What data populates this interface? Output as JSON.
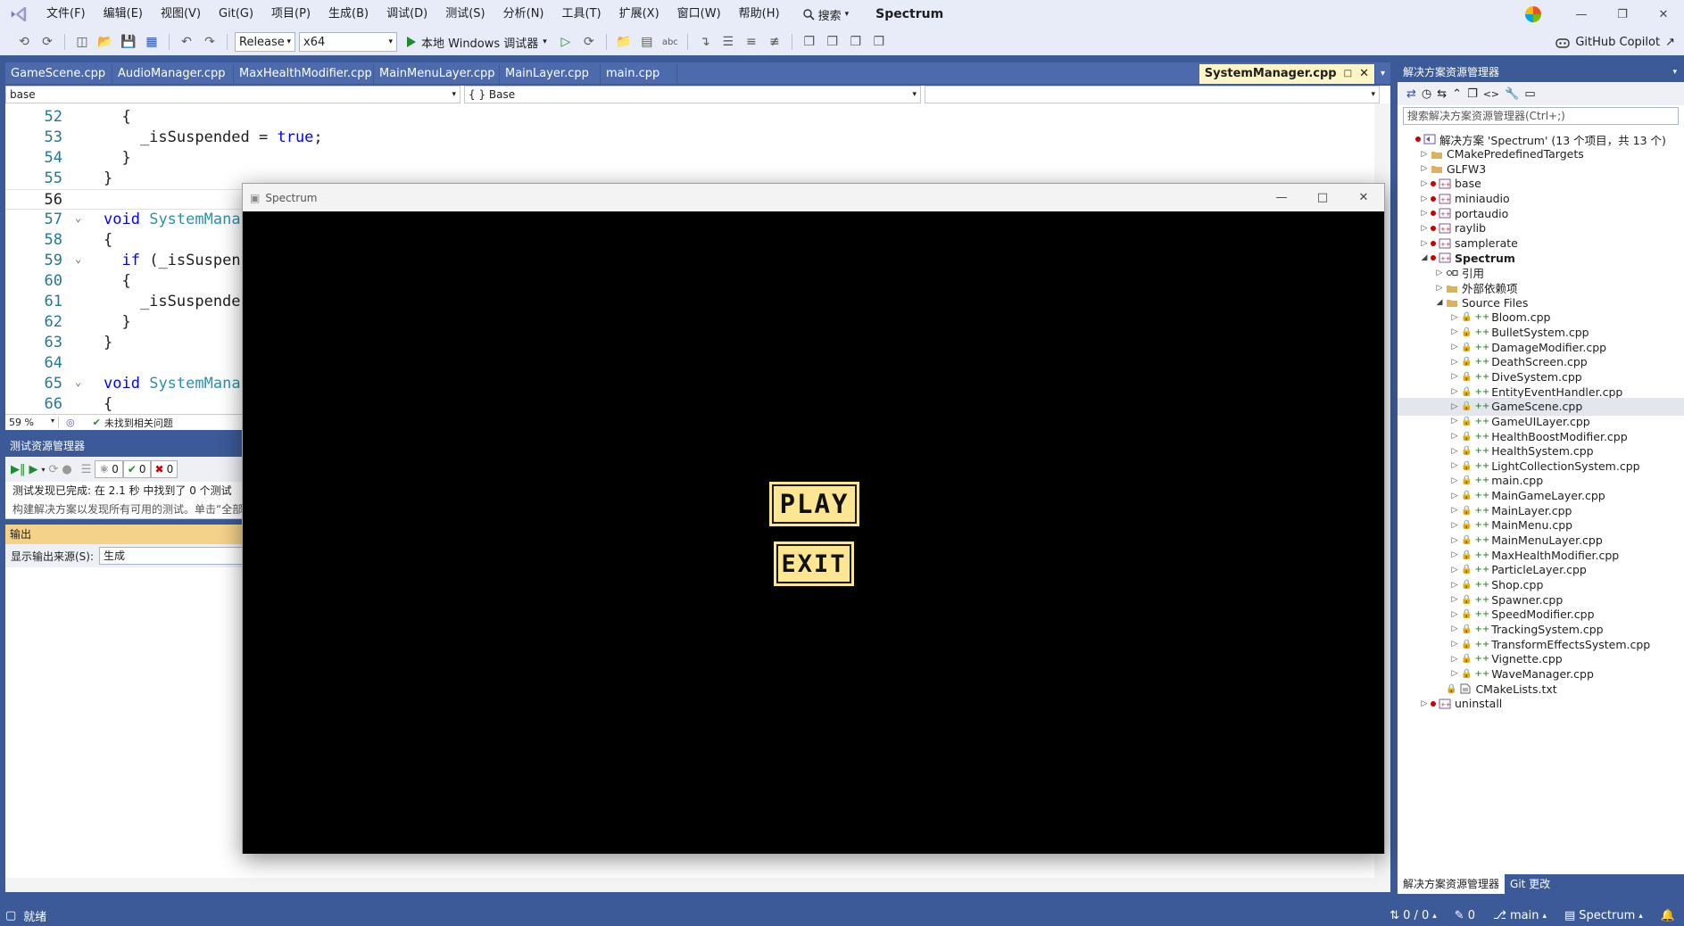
{
  "menu": [
    "文件(F)",
    "编辑(E)",
    "视图(V)",
    "Git(G)",
    "项目(P)",
    "生成(B)",
    "调试(D)",
    "测试(S)",
    "分析(N)",
    "工具(T)",
    "扩展(X)",
    "窗口(W)",
    "帮助(H)"
  ],
  "search_label": "搜索",
  "app_name": "Spectrum",
  "toolbar": {
    "config": "Release",
    "platform": "x64",
    "run_label": "本地 Windows 调试器",
    "copilot": "GitHub Copilot"
  },
  "doc_tabs": [
    "GameScene.cpp",
    "AudioManager.cpp",
    "MaxHealthModifier.cpp",
    "MainMenuLayer.cpp",
    "MainLayer.cpp",
    "main.cpp"
  ],
  "active_tab": "SystemManager.cpp",
  "nav": {
    "project": "base",
    "scope": "{ } Base",
    "member": ""
  },
  "code": [
    {
      "n": "52",
      "html": "  {"
    },
    {
      "n": "53",
      "html": "    _isSuspended = <span class=\"kw\">true</span>;"
    },
    {
      "n": "54",
      "html": "  }"
    },
    {
      "n": "55",
      "html": "}"
    },
    {
      "n": "56",
      "html": ""
    },
    {
      "n": "57",
      "html": "<span class=\"kw\">void</span> <span class=\"fn\">SystemMana</span>"
    },
    {
      "n": "58",
      "html": "{"
    },
    {
      "n": "59",
      "html": "  <span class=\"kw\">if</span> (_isSuspen"
    },
    {
      "n": "60",
      "html": "  {"
    },
    {
      "n": "61",
      "html": "    _isSuspende"
    },
    {
      "n": "62",
      "html": "  }"
    },
    {
      "n": "63",
      "html": "}"
    },
    {
      "n": "64",
      "html": ""
    },
    {
      "n": "65",
      "html": "<span class=\"kw\">void</span> <span class=\"fn\">SystemMana</span>"
    },
    {
      "n": "66",
      "html": "{"
    }
  ],
  "editor_status": {
    "zoom": "59 %",
    "issues": "未找到相关问题"
  },
  "test_explorer": {
    "title": "测试资源管理器",
    "counts": [
      "0",
      "0",
      "0"
    ],
    "status": "测试发现已完成: 在 2.1 秒 中找到了 0 个测试",
    "hint": "构建解决方案以发现所有可用的测试。单击“全部"
  },
  "output": {
    "title": "输出",
    "source_label": "显示输出来源(S):",
    "source_value": "生成"
  },
  "game": {
    "title": "Spectrum",
    "play": "PLAY",
    "exit": "EXIT",
    "button_color": "#fde692"
  },
  "solution": {
    "title": "解决方案资源管理器",
    "search": "搜索解决方案资源管理器(Ctrl+;)",
    "items": [
      {
        "label": "解决方案 'Spectrum' (13 个项目，共 13 个)",
        "depth": 0,
        "exp": "",
        "dot": true,
        "icon": "solution"
      },
      {
        "label": "CMakePredefinedTargets",
        "depth": 1,
        "exp": "▷",
        "dot": false,
        "icon": "folder"
      },
      {
        "label": "GLFW3",
        "depth": 1,
        "exp": "▷",
        "dot": false,
        "icon": "folder"
      },
      {
        "label": "base",
        "depth": 1,
        "exp": "▷",
        "dot": true,
        "icon": "project"
      },
      {
        "label": "miniaudio",
        "depth": 1,
        "exp": "▷",
        "dot": true,
        "icon": "project"
      },
      {
        "label": "portaudio",
        "depth": 1,
        "exp": "▷",
        "dot": true,
        "icon": "project"
      },
      {
        "label": "raylib",
        "depth": 1,
        "exp": "▷",
        "dot": true,
        "icon": "project"
      },
      {
        "label": "samplerate",
        "depth": 1,
        "exp": "▷",
        "dot": true,
        "icon": "project"
      },
      {
        "label": "Spectrum",
        "depth": 1,
        "exp": "◢",
        "dot": true,
        "icon": "project",
        "bold": true
      },
      {
        "label": "引用",
        "depth": 2,
        "exp": "▷",
        "dot": false,
        "icon": "ref"
      },
      {
        "label": "外部依赖项",
        "depth": 2,
        "exp": "▷",
        "dot": false,
        "icon": "folder"
      },
      {
        "label": "Source Files",
        "depth": 2,
        "exp": "◢",
        "dot": false,
        "icon": "folder"
      },
      {
        "label": "Bloom.cpp",
        "depth": 3,
        "exp": "▷",
        "file": true
      },
      {
        "label": "BulletSystem.cpp",
        "depth": 3,
        "exp": "▷",
        "file": true
      },
      {
        "label": "DamageModifier.cpp",
        "depth": 3,
        "exp": "▷",
        "file": true
      },
      {
        "label": "DeathScreen.cpp",
        "depth": 3,
        "exp": "▷",
        "file": true
      },
      {
        "label": "DiveSystem.cpp",
        "depth": 3,
        "exp": "▷",
        "file": true
      },
      {
        "label": "EntityEventHandler.cpp",
        "depth": 3,
        "exp": "▷",
        "file": true
      },
      {
        "label": "GameScene.cpp",
        "depth": 3,
        "exp": "▷",
        "file": true,
        "sel": true
      },
      {
        "label": "GameUILayer.cpp",
        "depth": 3,
        "exp": "▷",
        "file": true
      },
      {
        "label": "HealthBoostModifier.cpp",
        "depth": 3,
        "exp": "▷",
        "file": true
      },
      {
        "label": "HealthSystem.cpp",
        "depth": 3,
        "exp": "▷",
        "file": true
      },
      {
        "label": "LightCollectionSystem.cpp",
        "depth": 3,
        "exp": "▷",
        "file": true
      },
      {
        "label": "main.cpp",
        "depth": 3,
        "exp": "▷",
        "file": true
      },
      {
        "label": "MainGameLayer.cpp",
        "depth": 3,
        "exp": "▷",
        "file": true
      },
      {
        "label": "MainLayer.cpp",
        "depth": 3,
        "exp": "▷",
        "file": true
      },
      {
        "label": "MainMenu.cpp",
        "depth": 3,
        "exp": "▷",
        "file": true
      },
      {
        "label": "MainMenuLayer.cpp",
        "depth": 3,
        "exp": "▷",
        "file": true
      },
      {
        "label": "MaxHealthModifier.cpp",
        "depth": 3,
        "exp": "▷",
        "file": true
      },
      {
        "label": "ParticleLayer.cpp",
        "depth": 3,
        "exp": "▷",
        "file": true
      },
      {
        "label": "Shop.cpp",
        "depth": 3,
        "exp": "▷",
        "file": true
      },
      {
        "label": "Spawner.cpp",
        "depth": 3,
        "exp": "▷",
        "file": true
      },
      {
        "label": "SpeedModifier.cpp",
        "depth": 3,
        "exp": "▷",
        "file": true
      },
      {
        "label": "TrackingSystem.cpp",
        "depth": 3,
        "exp": "▷",
        "file": true
      },
      {
        "label": "TransformEffectsSystem.cpp",
        "depth": 3,
        "exp": "▷",
        "file": true
      },
      {
        "label": "Vignette.cpp",
        "depth": 3,
        "exp": "▷",
        "file": true
      },
      {
        "label": "WaveManager.cpp",
        "depth": 3,
        "exp": "▷",
        "file": true
      },
      {
        "label": "CMakeLists.txt",
        "depth": 2,
        "exp": "",
        "dot": false,
        "icon": "doc",
        "lock": true
      },
      {
        "label": "uninstall",
        "depth": 1,
        "exp": "▷",
        "dot": true,
        "icon": "project"
      }
    ],
    "bottom_tabs": [
      "解决方案资源管理器",
      "Git 更改"
    ]
  },
  "status": {
    "ready": "就绪",
    "lines": "0 / 0",
    "edits": "0",
    "branch": "main",
    "repo": "Spectrum"
  }
}
